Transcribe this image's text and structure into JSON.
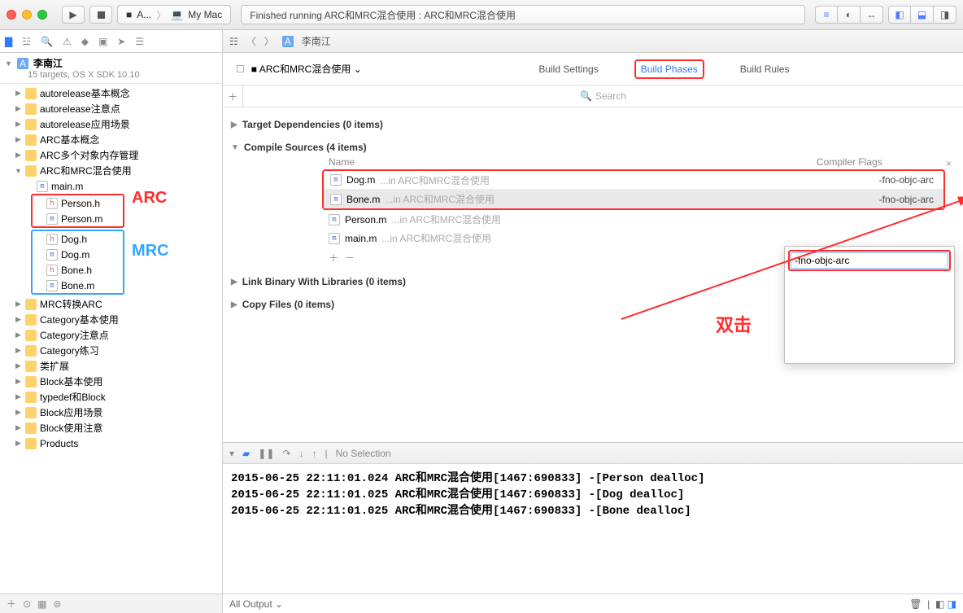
{
  "scheme": {
    "target": "A...",
    "device": "My Mac"
  },
  "status": "Finished running ARC和MRC混合使用 : ARC和MRC混合使用",
  "project": {
    "name": "李南江",
    "subtitle": "15 targets, OS X SDK 10.10"
  },
  "groups": [
    "autorelease基本概念",
    "autorelease注意点",
    "autorelease应用场景",
    "ARC基本概念",
    "ARC多个对象内存管理"
  ],
  "openGroup": "ARC和MRC混合使用",
  "openFiles": {
    "top": "main.m",
    "arc": [
      "Person.h",
      "Person.m"
    ],
    "mrc": [
      "Dog.h",
      "Dog.m",
      "Bone.h",
      "Bone.m"
    ]
  },
  "groupsAfter": [
    "MRC转换ARC",
    "Category基本使用",
    "Category注意点",
    "Category练习",
    "类扩展",
    "Block基本使用",
    "typedef和Block",
    "Block应用场景",
    "Block使用注意",
    "Products"
  ],
  "annot": {
    "arc": "ARC",
    "mrc": "MRC",
    "dbl": "双击"
  },
  "jumpbar": {
    "file": "李南江"
  },
  "targetName": "ARC和MRC混合使用",
  "tabs": {
    "settings": "Build Settings",
    "phases": "Build Phases",
    "rules": "Build Rules"
  },
  "searchPlaceholder": "Search",
  "sections": {
    "target": "Target Dependencies (0 items)",
    "compile": "Compile Sources (4 items)",
    "link": "Link Binary With Libraries (0 items)",
    "copy": "Copy Files (0 items)"
  },
  "cols": {
    "name": "Name",
    "flags": "Compiler Flags"
  },
  "compileRows": [
    {
      "file": "Dog.m",
      "group": "...in ARC和MRC混合使用",
      "flag": "-fno-objc-arc",
      "sel": false
    },
    {
      "file": "Bone.m",
      "group": "...in ARC和MRC混合使用",
      "flag": "-fno-objc-arc",
      "sel": true
    }
  ],
  "compileExtras": [
    {
      "file": "Person.m",
      "group": "...in ARC和MRC混合使用"
    },
    {
      "file": "main.m",
      "group": "...in ARC和MRC混合使用"
    }
  ],
  "popupValue": "-fno-objc-arc",
  "debugbar": {
    "label": "No Selection"
  },
  "consoleLines": [
    "2015-06-25 22:11:01.024 ARC和MRC混合使用[1467:690833] -[Person dealloc]",
    "2015-06-25 22:11:01.025 ARC和MRC混合使用[1467:690833] -[Dog dealloc]",
    "2015-06-25 22:11:01.025 ARC和MRC混合使用[1467:690833] -[Bone dealloc]"
  ],
  "consoleFilter": "All Output"
}
